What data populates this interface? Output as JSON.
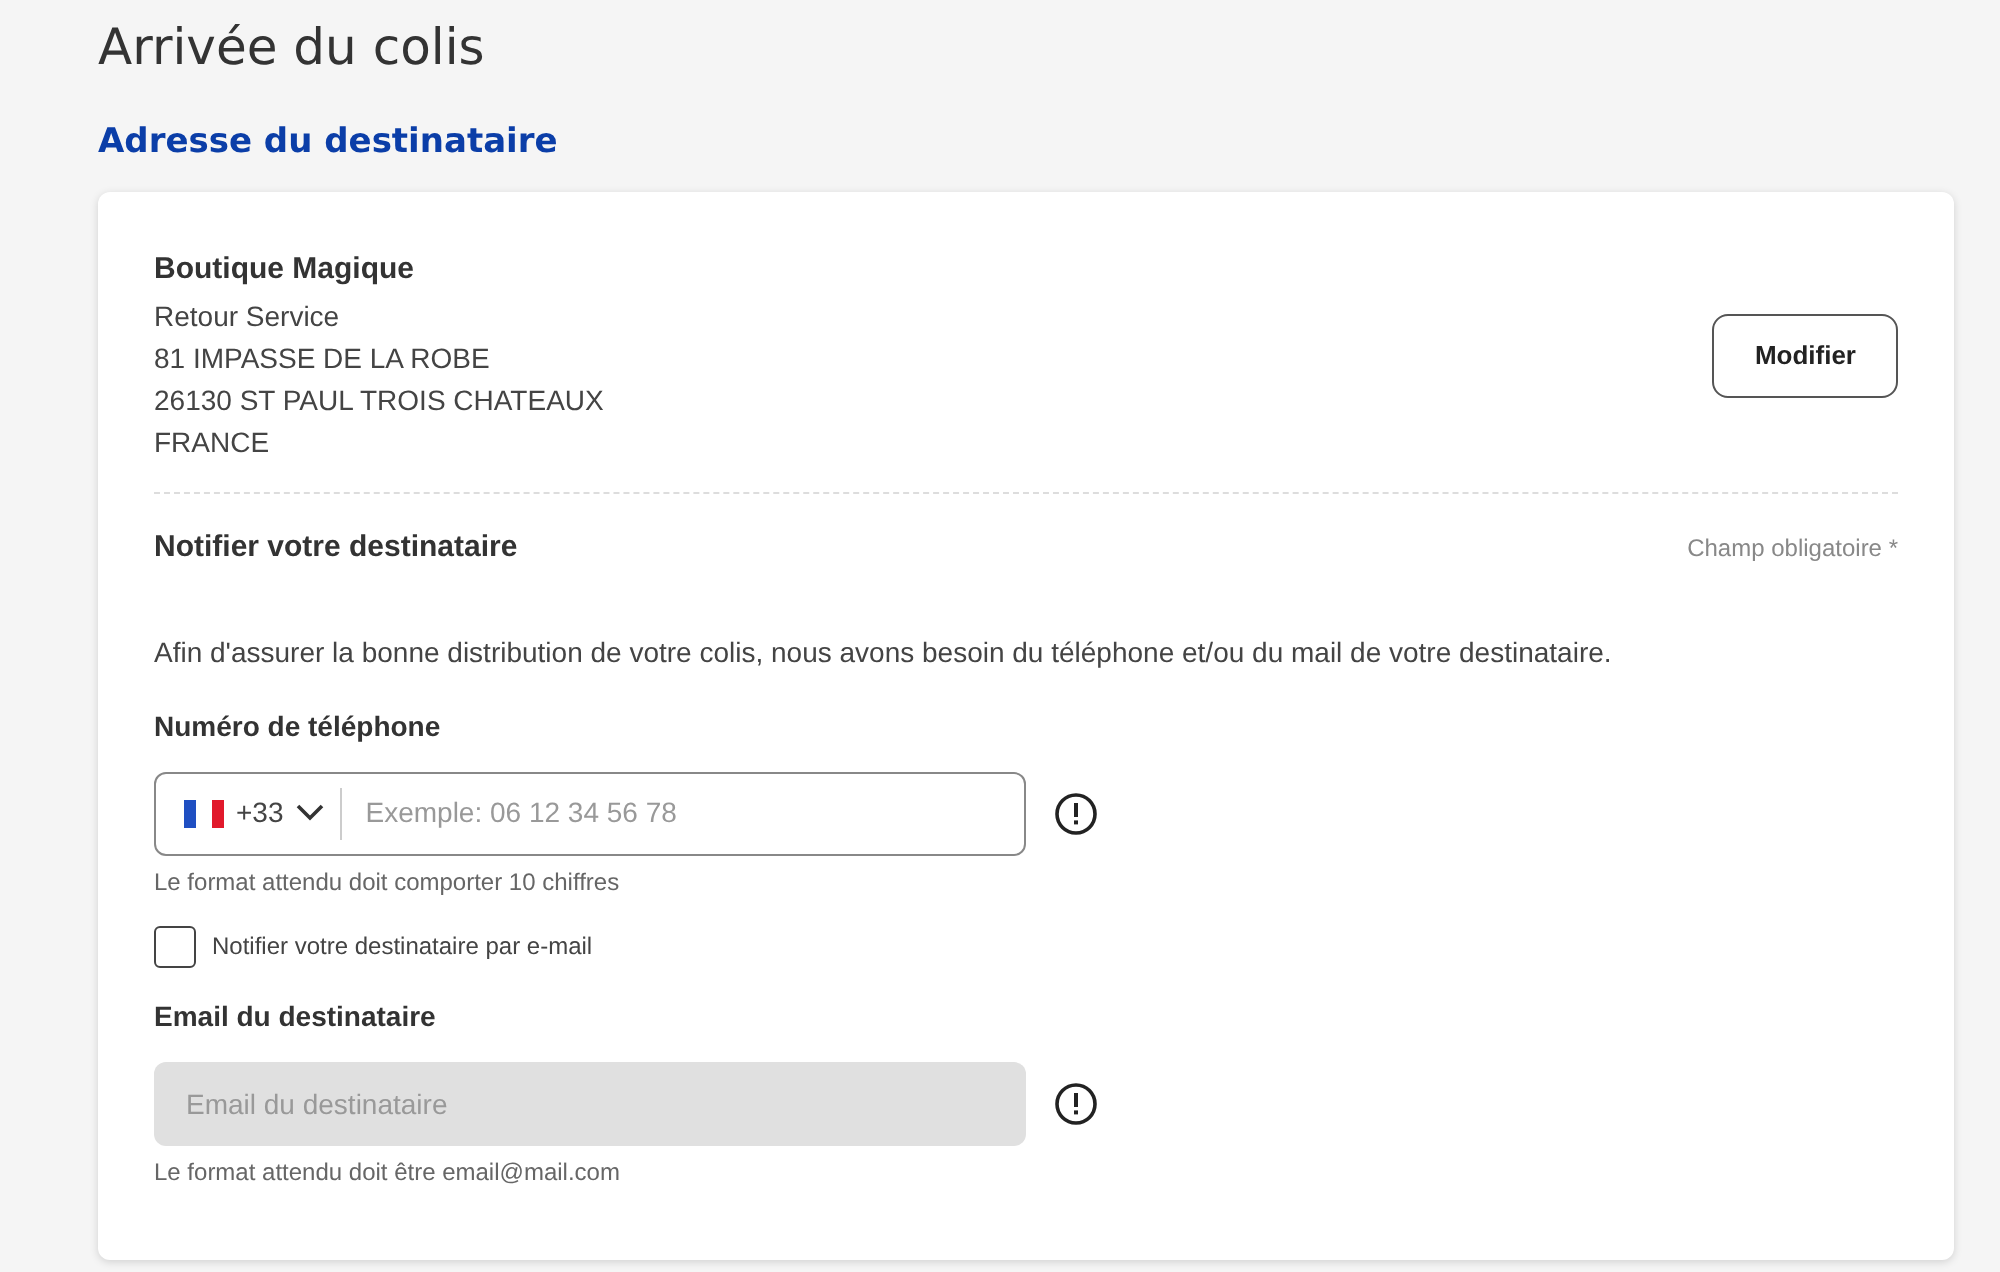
{
  "page_title": "Arrivée du colis",
  "section_title": "Adresse du destinataire",
  "address": {
    "name": "Boutique Magique",
    "lines": [
      "Retour Service",
      "81 IMPASSE DE LA ROBE",
      "26130 ST PAUL TROIS CHATEAUX",
      "FRANCE"
    ],
    "edit_button": "Modifier"
  },
  "notify": {
    "title": "Notifier votre destinataire",
    "required_note": "Champ obligatoire *",
    "intro": "Afin d'assurer la bonne distribution de votre colis, nous avons besoin du téléphone et/ou du mail de votre destinataire.",
    "phone": {
      "label": "Numéro de téléphone",
      "country_code": "+33",
      "placeholder": "Exemple: 06 12 34 56 78",
      "hint": "Le format attendu doit comporter 10 chiffres",
      "disabled": false
    },
    "email_option": {
      "label": "Notifier votre destinataire par e-mail",
      "checked": false
    },
    "email": {
      "label": "Email du destinataire",
      "placeholder": "Email du destinataire",
      "hint": "Le format attendu doit être email@mail.com",
      "disabled": true
    }
  }
}
